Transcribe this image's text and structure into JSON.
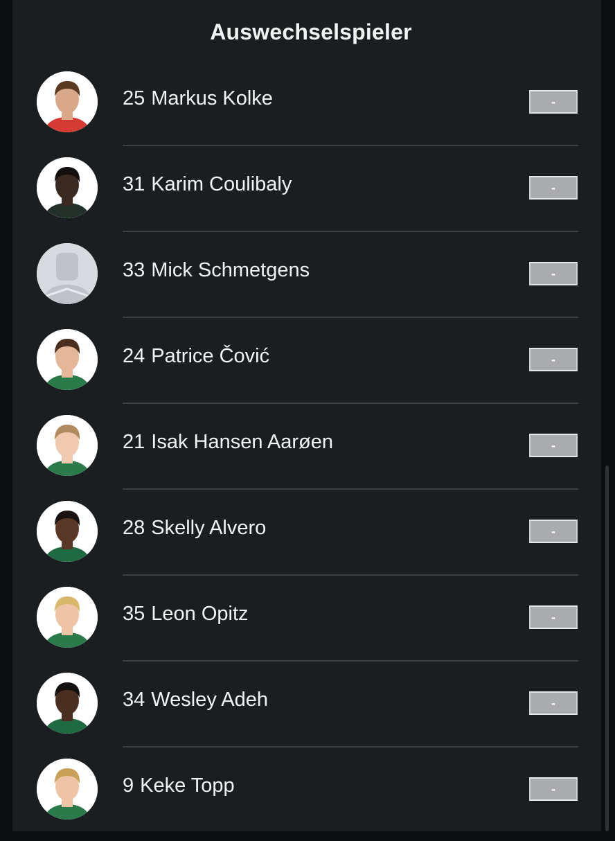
{
  "section": {
    "title": "Auswechselspieler"
  },
  "players": [
    {
      "number": "25",
      "name": "Markus Kolke",
      "rating": "-",
      "avatar_icon": "player-photo",
      "skin": "#d9a88a",
      "hair": "#5a3a22",
      "shirt": "#d63a35"
    },
    {
      "number": "31",
      "name": "Karim Coulibaly",
      "rating": "-",
      "avatar_icon": "player-photo",
      "skin": "#3a2a22",
      "hair": "#141010",
      "shirt": "#23302a"
    },
    {
      "number": "33",
      "name": "Mick Schmetgens",
      "rating": "-",
      "avatar_icon": "placeholder-person-icon"
    },
    {
      "number": "24",
      "name": "Patrice Čović",
      "rating": "-",
      "avatar_icon": "player-photo",
      "skin": "#e4b79a",
      "hair": "#4a2e1e",
      "shirt": "#2a7a4a"
    },
    {
      "number": "21",
      "name": "Isak Hansen Aarøen",
      "rating": "-",
      "avatar_icon": "player-photo",
      "skin": "#efc9b0",
      "hair": "#b08b60",
      "shirt": "#2a7a4a"
    },
    {
      "number": "28",
      "name": "Skelly Alvero",
      "rating": "-",
      "avatar_icon": "player-photo",
      "skin": "#5a3828",
      "hair": "#1a1210",
      "shirt": "#1f6a42"
    },
    {
      "number": "35",
      "name": "Leon Opitz",
      "rating": "-",
      "avatar_icon": "player-photo",
      "skin": "#efc4a6",
      "hair": "#d8b86a",
      "shirt": "#2a7a4a"
    },
    {
      "number": "34",
      "name": "Wesley Adeh",
      "rating": "-",
      "avatar_icon": "player-photo",
      "skin": "#4a2e22",
      "hair": "#141010",
      "shirt": "#1f6a42"
    },
    {
      "number": "9",
      "name": "Keke Topp",
      "rating": "-",
      "avatar_icon": "player-photo",
      "skin": "#efc4a6",
      "hair": "#c9a058",
      "shirt": "#2a7a4a"
    }
  ]
}
